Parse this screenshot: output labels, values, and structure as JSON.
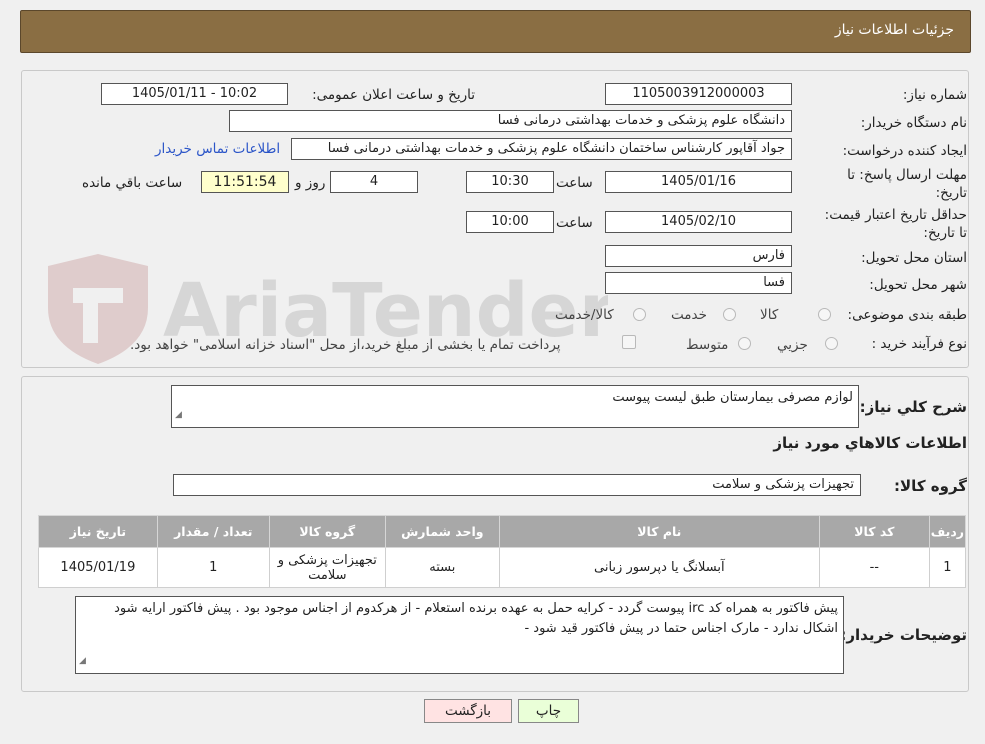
{
  "header": {
    "title": "جزئیات اطلاعات نیاز"
  },
  "form": {
    "need_number_label": "شماره نیاز:",
    "need_number": "1105003912000003",
    "announce_label": "تاریخ و ساعت اعلان عمومی:",
    "announce_value": "1405/01/11 - 10:02",
    "buyer_org_label": "نام دستگاه خریدار:",
    "buyer_org": "دانشگاه علوم پزشکی و خدمات بهداشتی درمانی فسا",
    "requester_label": "ایجاد کننده درخواست:",
    "requester": "جواد آقاپور کارشناس ساختمان دانشگاه علوم پزشکی و خدمات بهداشتی درمانی فسا",
    "contact_link": "اطلاعات تماس خریدار",
    "deadline_label": "مهلت ارسال پاسخ: تا تاریخ:",
    "deadline_date": "1405/01/16",
    "time_label": "ساعت",
    "deadline_time": "10:30",
    "days_value": "4",
    "days_label": "روز و",
    "remaining_time": "11:51:54",
    "remaining_label": "ساعت باقي مانده",
    "validity_label": "حداقل تاریخ اعتبار قیمت: تا تاریخ:",
    "validity_date": "1405/02/10",
    "validity_time": "10:00",
    "province_label": "استان محل تحویل:",
    "province": "فارس",
    "city_label": "شهر محل تحویل:",
    "city": "فسا",
    "category_label": "طبقه بندی موضوعی:",
    "category_options": [
      "کالا",
      "خدمت",
      "کالا/خدمت"
    ],
    "process_label": "نوع فرآیند خرید :",
    "process_options": [
      "جزيي",
      "متوسط"
    ],
    "treasury_note": "پرداخت تمام یا بخشی از مبلغ خرید،از محل \"اسناد خزانه اسلامی\" خواهد بود."
  },
  "details": {
    "summary_label": "شرح کلي نياز:",
    "summary": "لوازم مصرفی بیمارستان طبق لیست پیوست",
    "items_heading": "اطلاعات کالاهاي مورد نياز",
    "group_label": "گروه کالا:",
    "group_value": "تجهیزات پزشکی و سلامت",
    "table": {
      "headers": [
        "رديف",
        "کد کالا",
        "نام کالا",
        "واحد شمارش",
        "گروه کالا",
        "تعداد / مقدار",
        "تاريخ نياز"
      ],
      "rows": [
        [
          "1",
          "--",
          "آبسلانگ یا دپرسور زبانی",
          "بسته",
          "تجهیزات پزشکی و سلامت",
          "1",
          "1405/01/19"
        ]
      ]
    },
    "buyer_notes_label": "توضیحات خریدار:",
    "buyer_notes": "پیش فاکتور به همراه کد irc  پیوست گردد - کرایه حمل به عهده برنده استعلام - از هرکدوم از اجناس موجود بود . پیش فاکتور ارایه شود اشکال ندارد - مارک اجناس حتما در پیش فاکتور قید شود -"
  },
  "buttons": {
    "print": "چاپ",
    "back": "بازگشت"
  },
  "watermark_text": "AriaTender.neT",
  "colors": {
    "header": "#8a6e43",
    "link": "#2b55c8",
    "remaining_bg": "#ffffcc",
    "print_bg": "#eaffd8",
    "back_bg": "#ffe3e3"
  }
}
